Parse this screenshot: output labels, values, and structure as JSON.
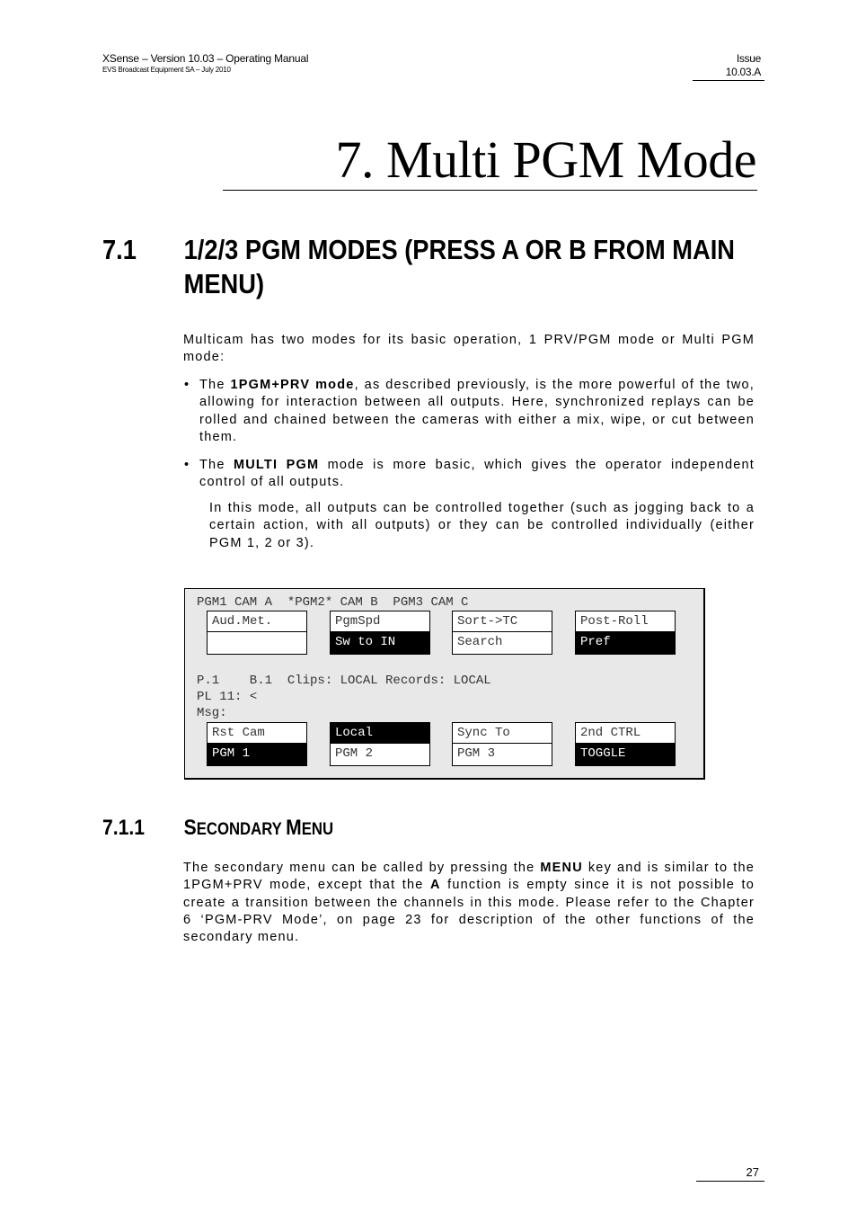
{
  "header": {
    "title": "XSense – Version 10.03 – Operating Manual",
    "subtitle": "EVS Broadcast Equipment SA – July 2010",
    "issue_label": "Issue",
    "issue_value": "10.03.A"
  },
  "chapter": {
    "title": "7. Multi PGM Mode"
  },
  "section_7_1": {
    "number": "7.1",
    "title": "1/2/3 PGM MODES (PRESS A OR B FROM MAIN MENU)",
    "intro": "Multicam has two modes for its basic operation, 1 PRV/PGM mode or Multi PGM mode:",
    "bullets": [
      {
        "prefix": "The ",
        "bold": "1PGM+PRV mode",
        "rest": ", as described previously, is the more powerful of the two, allowing for interaction between all outputs. Here, synchronized replays can be rolled and chained between the cameras with either a mix, wipe, or cut between them."
      },
      {
        "prefix": "The ",
        "bold": "MULTI PGM",
        "rest": " mode is more basic, which gives the operator independent control of all outputs."
      }
    ],
    "indented_paragraph": "In this mode, all outputs can be controlled together (such as jogging back to a certain action, with all outputs) or they can be controlled individually (either PGM 1, 2 or 3)."
  },
  "screen": {
    "status_line": "PGM1 CAM A  *PGM2* CAM B  PGM3 CAM C",
    "top_keys": [
      {
        "top": "Aud.Met.",
        "bottom": "",
        "top_inverted": false,
        "bottom_inverted": false
      },
      {
        "top": "PgmSpd",
        "bottom": "Sw to IN",
        "top_inverted": false,
        "bottom_inverted": true
      },
      {
        "top": "Sort->TC",
        "bottom": "Search",
        "top_inverted": false,
        "bottom_inverted": false
      },
      {
        "top": "Post-Roll",
        "bottom": "Pref",
        "top_inverted": false,
        "bottom_inverted": true
      }
    ],
    "info_line_1": "P.1    B.1  Clips: LOCAL Records: LOCAL",
    "info_line_2": "PL 11: <",
    "info_line_3": "Msg:",
    "bottom_keys": [
      {
        "top": "Rst Cam",
        "bottom": "PGM 1",
        "top_inverted": false,
        "bottom_inverted": true
      },
      {
        "top": "Local",
        "bottom": "PGM 2",
        "top_inverted": true,
        "bottom_inverted": false
      },
      {
        "top": "Sync To",
        "bottom": "PGM 3",
        "top_inverted": false,
        "bottom_inverted": false
      },
      {
        "top": "2nd CTRL",
        "bottom": "TOGGLE",
        "top_inverted": false,
        "bottom_inverted": true
      }
    ]
  },
  "section_7_1_1": {
    "number": "7.1.1",
    "title_cap1": "S",
    "title_rest1": "ECONDARY ",
    "title_cap2": "M",
    "title_rest2": "ENU",
    "p_part1": "The secondary menu can be called by pressing the ",
    "p_bold1": "MENU",
    "p_part2": " key and is similar to the 1PGM+PRV mode, except that the ",
    "p_bold2": "A",
    "p_part3": " function is empty since it is not possible to create a transition between the channels in this mode. Please refer to the Chapter 6 ‘PGM-PRV Mode’, on page 23 for description of the other functions of the secondary menu."
  },
  "footer": {
    "page_number": "27"
  }
}
